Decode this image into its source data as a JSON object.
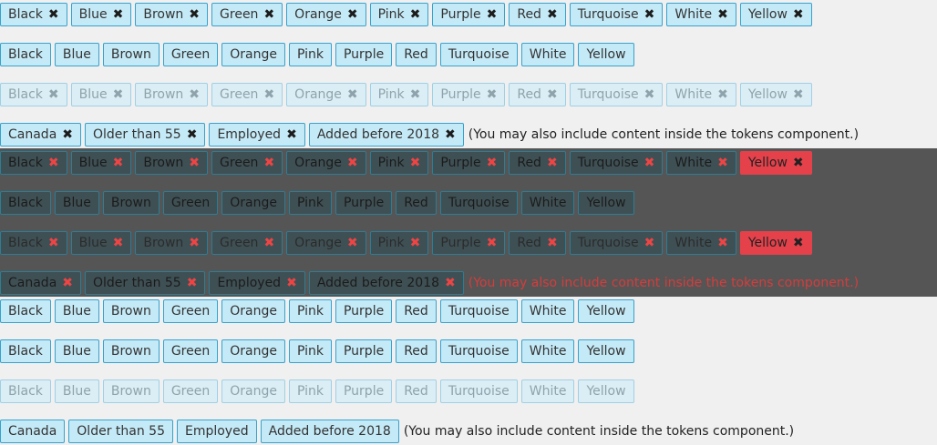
{
  "colors": {
    "token_bg": "#c5eaf7",
    "token_border": "#37a2cc",
    "dark_band": "#555555",
    "error_red": "#e5414b"
  },
  "colors_list": [
    "Black",
    "Blue",
    "Brown",
    "Green",
    "Orange",
    "Pink",
    "Purple",
    "Red",
    "Turquoise",
    "White",
    "Yellow"
  ],
  "filters": [
    "Canada",
    "Older than 55",
    "Employed",
    "Added before 2018"
  ],
  "note": "(You may also include content inside the tokens component.)",
  "remove_icon": "✖"
}
